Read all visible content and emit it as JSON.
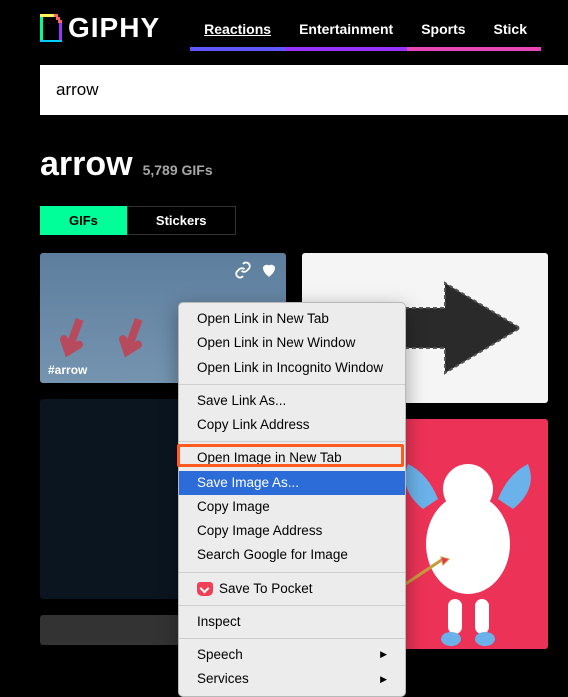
{
  "brand": "GIPHY",
  "nav": {
    "reactions": "Reactions",
    "entertainment": "Entertainment",
    "sports": "Sports",
    "stickers": "Stick"
  },
  "search": {
    "value": "arrow"
  },
  "page": {
    "title": "arrow",
    "count": "5,789 GIFs"
  },
  "tabs": {
    "gifs": "GIFs",
    "stickers": "Stickers"
  },
  "thumb1": {
    "tag": "#arrow"
  },
  "context_menu": {
    "open_link_new_tab": "Open Link in New Tab",
    "open_link_new_window": "Open Link in New Window",
    "open_link_incognito": "Open Link in Incognito Window",
    "save_link_as": "Save Link As...",
    "copy_link_address": "Copy Link Address",
    "open_image_new_tab": "Open Image in New Tab",
    "save_image_as": "Save Image As...",
    "copy_image": "Copy Image",
    "copy_image_address": "Copy Image Address",
    "search_google": "Search Google for Image",
    "save_to_pocket": "Save To Pocket",
    "inspect": "Inspect",
    "speech": "Speech",
    "services": "Services"
  }
}
